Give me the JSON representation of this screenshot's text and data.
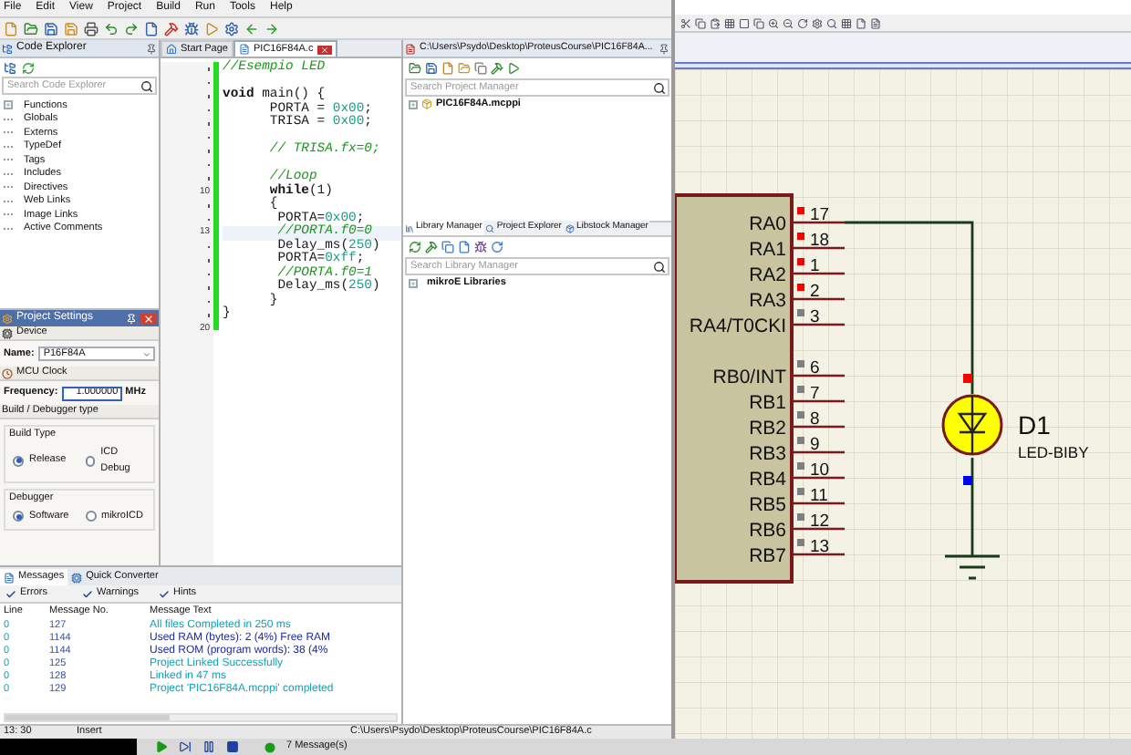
{
  "mikroc": {
    "menu": [
      "File",
      "Edit",
      "View",
      "Project",
      "Build",
      "Run",
      "Tools",
      "Help"
    ],
    "code_explorer": {
      "title": "Code Explorer",
      "search": {
        "placeholder": "Search Code Explorer"
      },
      "items": [
        {
          "label": "Functions",
          "kind": "group"
        },
        {
          "label": "Globals",
          "kind": "leaf"
        },
        {
          "label": "Externs",
          "kind": "leaf"
        },
        {
          "label": "TypeDef",
          "kind": "leaf"
        },
        {
          "label": "Tags",
          "kind": "leaf"
        },
        {
          "label": "Includes",
          "kind": "leaf"
        },
        {
          "label": "Directives",
          "kind": "leaf"
        },
        {
          "label": "Web Links",
          "kind": "leaf"
        },
        {
          "label": "Image Links",
          "kind": "leaf"
        },
        {
          "label": "Active Comments",
          "kind": "leaf"
        }
      ]
    },
    "project_settings": {
      "title": "Project Settings",
      "device": {
        "header": "Device",
        "name_label": "Name:",
        "name_value": "P16F84A"
      },
      "clock": {
        "header": "MCU Clock",
        "frequency_label": "Frequency:",
        "frequency_value": "1.000000",
        "unit": "MHz"
      },
      "build": {
        "header": "Build / Debugger type",
        "groups": [
          {
            "label": "Build Type",
            "options": [
              {
                "label": "Release",
                "selected": true
              },
              {
                "label": "ICD Debug",
                "selected": false
              }
            ]
          },
          {
            "label": "Debugger",
            "options": [
              {
                "label": "Software",
                "selected": true
              },
              {
                "label": "mikroICD",
                "selected": false
              }
            ]
          }
        ]
      }
    },
    "editor": {
      "tabs": [
        {
          "label": "Start Page",
          "selected": false
        },
        {
          "label": "PIC16F84A.c",
          "selected": true
        }
      ],
      "lines": [
        {
          "kind": "code",
          "current": false,
          "tokens": [
            {
              "text": "//Esempio LED",
              "kind": "comment"
            }
          ]
        },
        {
          "kind": "blank"
        },
        {
          "kind": "code",
          "current": false,
          "tokens": [
            {
              "text": "void",
              "kind": "keyword"
            },
            {
              "text": " main() {",
              "kind": "plain"
            }
          ]
        },
        {
          "kind": "code",
          "current": false,
          "tokens": [
            {
              "text": "      PORTA = ",
              "kind": "plain"
            },
            {
              "text": "0x00",
              "kind": "number"
            },
            {
              "text": ";",
              "kind": "plain"
            }
          ]
        },
        {
          "kind": "code",
          "current": false,
          "tokens": [
            {
              "text": "      TRISA = ",
              "kind": "plain"
            },
            {
              "text": "0x00",
              "kind": "number"
            },
            {
              "text": ";",
              "kind": "plain"
            }
          ]
        },
        {
          "kind": "blank"
        },
        {
          "kind": "code",
          "current": false,
          "tokens": [
            {
              "text": "      // TRISA.fx=0;",
              "kind": "comment"
            }
          ]
        },
        {
          "kind": "blank"
        },
        {
          "kind": "code",
          "current": false,
          "tokens": [
            {
              "text": "      //Loop",
              "kind": "comment"
            }
          ]
        },
        {
          "kind": "code",
          "number": "10",
          "current": false,
          "tokens": [
            {
              "text": "      while",
              "kind": "keyword"
            },
            {
              "text": "(1)",
              "kind": "plain"
            }
          ]
        },
        {
          "kind": "code",
          "current": false,
          "tokens": [
            {
              "text": "      {",
              "kind": "plain"
            }
          ]
        },
        {
          "kind": "code",
          "current": false,
          "tokens": [
            {
              "text": "       PORTA=",
              "kind": "plain"
            },
            {
              "text": "0x00",
              "kind": "number"
            },
            {
              "text": ";",
              "kind": "plain"
            }
          ]
        },
        {
          "kind": "code",
          "number": "13",
          "current": true,
          "tokens": [
            {
              "text": "       //PORTA.f0=0",
              "kind": "comment"
            }
          ]
        },
        {
          "kind": "code",
          "current": false,
          "tokens": [
            {
              "text": "       Delay_ms(",
              "kind": "plain"
            },
            {
              "text": "250",
              "kind": "number"
            },
            {
              "text": ")",
              "kind": "plain"
            }
          ]
        },
        {
          "kind": "code",
          "current": false,
          "tokens": [
            {
              "text": "       PORTA=",
              "kind": "plain"
            },
            {
              "text": "0xff",
              "kind": "number"
            },
            {
              "text": ";",
              "kind": "plain"
            }
          ]
        },
        {
          "kind": "code",
          "current": false,
          "tokens": [
            {
              "text": "       //PORTA.f0=1",
              "kind": "comment"
            }
          ]
        },
        {
          "kind": "code",
          "current": false,
          "tokens": [
            {
              "text": "       Delay_ms(",
              "kind": "plain"
            },
            {
              "text": "250",
              "kind": "number"
            },
            {
              "text": ")",
              "kind": "plain"
            }
          ]
        },
        {
          "kind": "code",
          "current": false,
          "tokens": [
            {
              "text": "      }",
              "kind": "plain"
            }
          ]
        },
        {
          "kind": "code",
          "current": false,
          "tokens": [
            {
              "text": "}",
              "kind": "plain"
            }
          ]
        },
        {
          "kind": "blank",
          "number": "20"
        }
      ]
    },
    "project_manager": {
      "title": "C:\\Users\\Psydo\\Desktop\\ProteusCourse\\PIC16F84A...",
      "search": {
        "placeholder": "Search Project Manager"
      },
      "items": [
        "PIC16F84A.mcppi"
      ]
    },
    "library_manager": {
      "tabs": [
        {
          "label": "Library Manager",
          "selected": true
        },
        {
          "label": "Project Explorer",
          "selected": false
        },
        {
          "label": "Libstock Manager",
          "selected": false
        }
      ],
      "search": {
        "placeholder": "Search Library Manager"
      },
      "items": [
        "mikroE Libraries"
      ]
    },
    "messages": {
      "tabs": [
        {
          "label": "Messages",
          "selected": true
        },
        {
          "label": "Quick Converter",
          "selected": false
        }
      ],
      "filters": [
        {
          "label": "Errors",
          "checked": true
        },
        {
          "label": "Warnings",
          "checked": true
        },
        {
          "label": "Hints",
          "checked": true
        }
      ],
      "columns": [
        "Line",
        "Message No.",
        "Message Text"
      ],
      "rows": [
        {
          "line": "0",
          "number": "127",
          "text": "All files Completed in 250 ms",
          "color": "#14a0b4"
        },
        {
          "line": "0",
          "number": "1144",
          "text": "Used RAM (bytes): 2 (4%)  Free RAM",
          "color": "#1e2a9c"
        },
        {
          "line": "0",
          "number": "1144",
          "text": "Used ROM (program words): 38 (4%",
          "color": "#1e2a9c"
        },
        {
          "line": "0",
          "number": "125",
          "text": "Project Linked Successfully",
          "color": "#14a0b4"
        },
        {
          "line": "0",
          "number": "128",
          "text": "Linked in 47 ms",
          "color": "#14a0b4"
        },
        {
          "line": "0",
          "number": "129",
          "text": "Project 'PIC16F84A.mcppi' completed",
          "color": "#14a0b4"
        }
      ]
    },
    "status_bar": [
      "13: 30",
      "Insert",
      "C:\\Users\\Psydo\\Desktop\\ProteusCourse\\PIC16F84A.c"
    ]
  },
  "proteus": {
    "schematic": {
      "chip": {
        "pin_groups": [
          {
            "pins": [
              {
                "name": "RA0",
                "number": "17",
                "color": "#ff0000"
              },
              {
                "name": "RA1",
                "number": "18",
                "color": "#ff0000"
              },
              {
                "name": "RA2",
                "number": "1",
                "color": "#ff0000"
              },
              {
                "name": "RA3",
                "number": "2",
                "color": "#ff0000"
              },
              {
                "name": "RA4/T0CKI",
                "number": "3",
                "color": "#808080"
              }
            ]
          },
          {
            "pins": [
              {
                "name": "RB0/INT",
                "number": "6",
                "color": "#808080"
              },
              {
                "name": "RB1",
                "number": "7",
                "color": "#808080"
              },
              {
                "name": "RB2",
                "number": "8",
                "color": "#808080"
              },
              {
                "name": "RB3",
                "number": "9",
                "color": "#808080"
              },
              {
                "name": "RB4",
                "number": "10",
                "color": "#808080"
              },
              {
                "name": "RB5",
                "number": "11",
                "color": "#808080"
              },
              {
                "name": "RB6",
                "number": "12",
                "color": "#808080"
              },
              {
                "name": "RB7",
                "number": "13",
                "color": "#808080"
              }
            ]
          }
        ]
      },
      "led": {
        "reference": "D1",
        "value": "LED-BIBY",
        "lit": true,
        "terminals": [
          {
            "color": "#ff0000"
          },
          {
            "color": "#0000ff"
          }
        ]
      }
    },
    "bottom_bar": {
      "messages": "7 Message(s)"
    }
  }
}
